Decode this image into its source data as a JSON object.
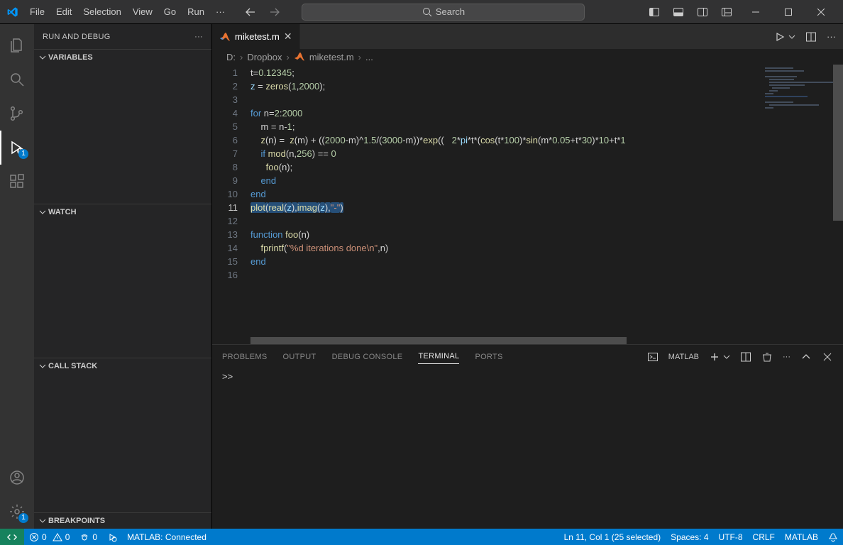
{
  "menubar": {
    "items": [
      "File",
      "Edit",
      "Selection",
      "View",
      "Go",
      "Run"
    ],
    "overflow": "···"
  },
  "titlebar": {
    "search_placeholder": "Search"
  },
  "activitybar": {
    "run_badge": "1",
    "settings_badge": "1"
  },
  "sidebar": {
    "title": "RUN AND DEBUG",
    "sections": {
      "variables": "VARIABLES",
      "watch": "WATCH",
      "callstack": "CALL STACK",
      "breakpoints": "BREAKPOINTS"
    }
  },
  "tab": {
    "filename": "miketest.m"
  },
  "breadcrumbs": {
    "parts": [
      "D:",
      "Dropbox",
      "miketest.m",
      "..."
    ]
  },
  "editor": {
    "line_numbers": [
      "1",
      "2",
      "3",
      "4",
      "5",
      "6",
      "7",
      "8",
      "9",
      "10",
      "11",
      "12",
      "13",
      "14",
      "15",
      "16"
    ],
    "current_line": 11,
    "lines": [
      [
        [
          "def",
          "t="
        ],
        [
          "num",
          "0.12345"
        ],
        [
          "def",
          ";"
        ]
      ],
      [
        [
          "var",
          "z"
        ],
        [
          "def",
          " = "
        ],
        [
          "fn",
          "zeros"
        ],
        [
          "def",
          "("
        ],
        [
          "num",
          "1"
        ],
        [
          "def",
          ","
        ],
        [
          "num",
          "2000"
        ],
        [
          "def",
          ");"
        ]
      ],
      [],
      [
        [
          "kw",
          "for"
        ],
        [
          "def",
          " n="
        ],
        [
          "num",
          "2"
        ],
        [
          "def",
          ":"
        ],
        [
          "num",
          "2000"
        ]
      ],
      [
        [
          "def",
          "    m = n-"
        ],
        [
          "num",
          "1"
        ],
        [
          "def",
          ";"
        ]
      ],
      [
        [
          "def",
          "    "
        ],
        [
          "fn",
          "z"
        ],
        [
          "def",
          "(n) =  "
        ],
        [
          "fn",
          "z"
        ],
        [
          "def",
          "(m) + (("
        ],
        [
          "num",
          "2000"
        ],
        [
          "def",
          "-m)^"
        ],
        [
          "num",
          "1.5"
        ],
        [
          "def",
          "/("
        ],
        [
          "num",
          "3000"
        ],
        [
          "def",
          "-m))*"
        ],
        [
          "fn",
          "exp"
        ],
        [
          "def",
          "((   "
        ],
        [
          "num",
          "2"
        ],
        [
          "def",
          "*"
        ],
        [
          "var",
          "pi"
        ],
        [
          "def",
          "*t*("
        ],
        [
          "fn",
          "cos"
        ],
        [
          "def",
          "(t*"
        ],
        [
          "num",
          "100"
        ],
        [
          "def",
          ")*"
        ],
        [
          "fn",
          "sin"
        ],
        [
          "def",
          "(m*"
        ],
        [
          "num",
          "0.05"
        ],
        [
          "def",
          "+t*"
        ],
        [
          "num",
          "30"
        ],
        [
          "def",
          ")*"
        ],
        [
          "num",
          "10"
        ],
        [
          "def",
          "+t*"
        ],
        [
          "num",
          "1"
        ]
      ],
      [
        [
          "def",
          "    "
        ],
        [
          "kw",
          "if"
        ],
        [
          "def",
          " "
        ],
        [
          "fn",
          "mod"
        ],
        [
          "def",
          "(n,"
        ],
        [
          "num",
          "256"
        ],
        [
          "def",
          ") == "
        ],
        [
          "num",
          "0"
        ]
      ],
      [
        [
          "def",
          "      "
        ],
        [
          "fn",
          "foo"
        ],
        [
          "def",
          "(n);"
        ]
      ],
      [
        [
          "def",
          "    "
        ],
        [
          "kw",
          "end"
        ]
      ],
      [
        [
          "kw",
          "end"
        ]
      ],
      [
        [
          "sel-start"
        ],
        [
          "fn",
          "plot"
        ],
        [
          "def",
          "("
        ],
        [
          "fn",
          "real"
        ],
        [
          "def",
          "("
        ],
        [
          "var",
          "z"
        ],
        [
          "def",
          "),"
        ],
        [
          "fn",
          "imag"
        ],
        [
          "def",
          "("
        ],
        [
          "var",
          "z"
        ],
        [
          "def",
          "),"
        ],
        [
          "str",
          "\"-\""
        ],
        [
          "def",
          ")"
        ],
        [
          "sel-end"
        ]
      ],
      [],
      [
        [
          "kw",
          "function"
        ],
        [
          "def",
          " "
        ],
        [
          "fn",
          "foo"
        ],
        [
          "def",
          "(n)"
        ]
      ],
      [
        [
          "def",
          "    "
        ],
        [
          "fn",
          "fprintf"
        ],
        [
          "def",
          "("
        ],
        [
          "str",
          "\"%d iterations done\\n\""
        ],
        [
          "def",
          ",n)"
        ]
      ],
      [
        [
          "kw",
          "end"
        ]
      ],
      []
    ]
  },
  "panel": {
    "tabs": {
      "problems": "PROBLEMS",
      "output": "OUTPUT",
      "debug": "DEBUG CONSOLE",
      "terminal": "TERMINAL",
      "ports": "PORTS"
    },
    "active": "terminal",
    "terminal_label": "MATLAB",
    "prompt": ">>"
  },
  "status": {
    "errors": "0",
    "warnings": "0",
    "ports": "0",
    "matlab": "MATLAB: Connected",
    "cursor": "Ln 11, Col 1 (25 selected)",
    "spaces": "Spaces: 4",
    "encoding": "UTF-8",
    "eol": "CRLF",
    "lang": "MATLAB"
  }
}
